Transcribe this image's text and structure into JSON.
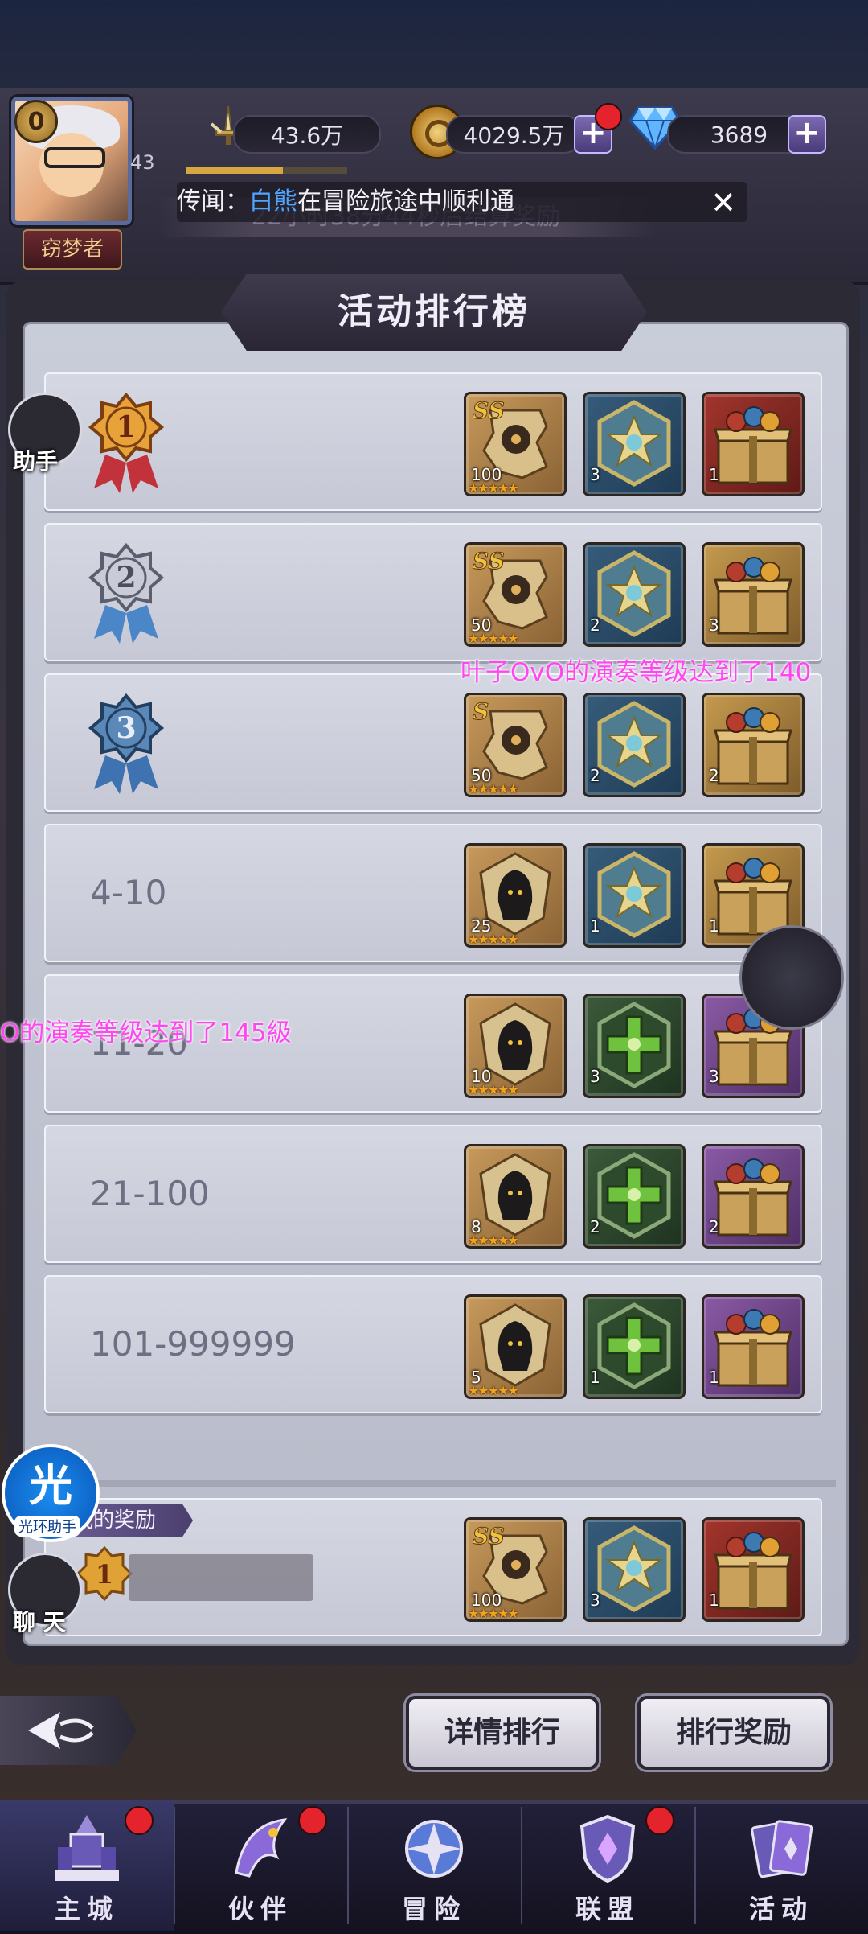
{
  "header": {
    "vip_level": "0",
    "player_level": "43",
    "exp_progress": 0.6,
    "title_badge": "窃梦者",
    "power": "43.6万",
    "gold": "4029.5万",
    "gems": "3689",
    "timer_banner": "22小时38分44秒后结算奖励",
    "rumor_prefix": "传闻：",
    "rumor_name": "白熊",
    "rumor_suffix": "在冒险旅途中顺利通",
    "plus_symbol": "+",
    "close_symbol": "✕"
  },
  "panel": {
    "title": "活动排行榜"
  },
  "ranks": [
    {
      "rank": "1",
      "rewards": [
        {
          "type": "ss-fragment",
          "count": "100",
          "stars": "★★★★★"
        },
        {
          "type": "blue-star-emblem",
          "count": "3"
        },
        {
          "type": "red-gift-box",
          "count": "1"
        }
      ]
    },
    {
      "rank": "2",
      "rewards": [
        {
          "type": "ss-fragment",
          "count": "50",
          "stars": "★★★★★"
        },
        {
          "type": "blue-star-emblem",
          "count": "2"
        },
        {
          "type": "gold-gift-box",
          "count": "3"
        }
      ]
    },
    {
      "rank": "3",
      "rewards": [
        {
          "type": "s-fragment",
          "count": "50",
          "stars": "★★★★★"
        },
        {
          "type": "blue-star-emblem",
          "count": "2"
        },
        {
          "type": "gold-gift-box",
          "count": "2"
        }
      ]
    },
    {
      "rank": "4-10",
      "rewards": [
        {
          "type": "hooded-fragment",
          "count": "25",
          "stars": "★★★★★"
        },
        {
          "type": "blue-star-emblem",
          "count": "1"
        },
        {
          "type": "gold-gift-box",
          "count": "1"
        }
      ]
    },
    {
      "rank": "11-20",
      "rewards": [
        {
          "type": "hooded-fragment",
          "count": "10",
          "stars": "★★★★★"
        },
        {
          "type": "green-cross-emblem",
          "count": "3"
        },
        {
          "type": "purple-gift-box",
          "count": "3"
        }
      ]
    },
    {
      "rank": "21-100",
      "rewards": [
        {
          "type": "hooded-fragment",
          "count": "8",
          "stars": "★★★★★"
        },
        {
          "type": "green-cross-emblem",
          "count": "2"
        },
        {
          "type": "purple-gift-box",
          "count": "2"
        }
      ]
    },
    {
      "rank": "101-999999",
      "rewards": [
        {
          "type": "hooded-fragment",
          "count": "5",
          "stars": "★★★★★"
        },
        {
          "type": "green-cross-emblem",
          "count": "1"
        },
        {
          "type": "purple-gift-box",
          "count": "1"
        }
      ]
    }
  ],
  "my_reward": {
    "label": "我的奖励",
    "rank": "1",
    "rewards": [
      {
        "type": "ss-fragment",
        "count": "100",
        "stars": "★★★★★"
      },
      {
        "type": "blue-star-emblem",
        "count": "3"
      },
      {
        "type": "red-gift-box",
        "count": "1"
      }
    ]
  },
  "side": {
    "assistant": "助手",
    "halo_char": "光",
    "halo_label": "光环助手",
    "chat": "聊 天"
  },
  "tickers": {
    "t1": "叶子OvO的演奏等级达到了140",
    "t2": "O的演奏等级达到了145級"
  },
  "buttons": {
    "detail_rank": "详情排行",
    "rank_reward": "排行奖励"
  },
  "nav": [
    {
      "label": "主城",
      "active": true,
      "badge": true
    },
    {
      "label": "伙伴",
      "active": false,
      "badge": true
    },
    {
      "label": "冒险",
      "active": false,
      "badge": false
    },
    {
      "label": "联盟",
      "active": false,
      "badge": true
    },
    {
      "label": "活动",
      "active": false,
      "badge": false
    }
  ],
  "colors": {
    "accent_gold": "#d8a640",
    "badge_red": "#e5232c",
    "rumor_highlight": "#4fa6ff",
    "ticker_pink": "#ff46f0"
  }
}
